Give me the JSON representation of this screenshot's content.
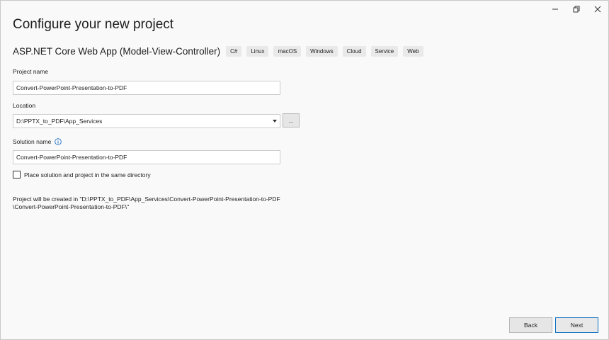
{
  "window": {
    "controls": {
      "minimize_icon": "minimize-icon",
      "restore_icon": "restore-icon",
      "close_icon": "close-icon"
    }
  },
  "page": {
    "title": "Configure your new project"
  },
  "template": {
    "name": "ASP.NET Core Web App (Model-View-Controller)",
    "tags": [
      "C#",
      "Linux",
      "macOS",
      "Windows",
      "Cloud",
      "Service",
      "Web"
    ]
  },
  "project_name": {
    "label": "Project name",
    "value": "Convert-PowerPoint-Presentation-to-PDF"
  },
  "location": {
    "label": "Location",
    "value": "D:\\PPTX_to_PDF\\App_Services",
    "browse_label": "..."
  },
  "solution_name": {
    "label": "Solution name",
    "value": "Convert-PowerPoint-Presentation-to-PDF",
    "info_icon": "info-icon"
  },
  "same_directory": {
    "label": "Place solution and project in the same directory",
    "checked": false
  },
  "path_info": {
    "line1": "Project will be created in \"D:\\PPTX_to_PDF\\App_Services\\Convert-PowerPoint-Presentation-to-PDF",
    "line2": "\\Convert-PowerPoint-Presentation-to-PDF\\\""
  },
  "footer": {
    "back_label": "Back",
    "next_label": "Next"
  },
  "colors": {
    "background": "#f9f9f9",
    "accent_border": "#0e70c0",
    "info_icon": "#1f6fc2"
  }
}
